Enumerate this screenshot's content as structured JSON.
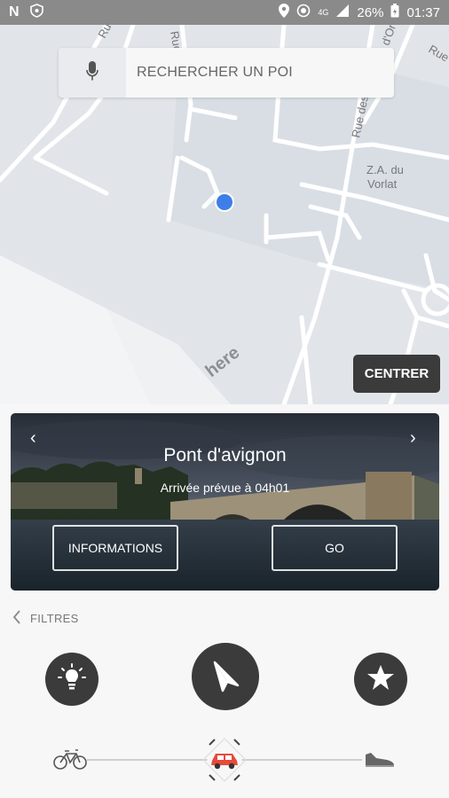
{
  "status_bar": {
    "battery": "26%",
    "time": "01:37",
    "network": "4G"
  },
  "map": {
    "street_labels": [
      "Rue de",
      "Rue d",
      "Rue des",
      "d'Or",
      "Rue",
      "Z.A. du",
      "Vorlat"
    ],
    "watermark": "here"
  },
  "search": {
    "placeholder": "RECHERCHER UN POI"
  },
  "center_button": "CENTRER",
  "poi_card": {
    "title": "Pont d'avignon",
    "eta": "Arrivée prévue à 04h01",
    "info_button": "INFORMATIONS",
    "go_button": "GO",
    "prev_icon": "chevron-left-icon",
    "next_icon": "chevron-right-icon"
  },
  "filters": {
    "label": "FILTRES"
  },
  "actions": [
    "lightbulb-icon",
    "navigation-arrow-icon",
    "star-icon"
  ],
  "transport_modes": [
    {
      "name": "bicycle-icon",
      "selected": false
    },
    {
      "name": "car-icon",
      "selected": true
    },
    {
      "name": "walking-shoe-icon",
      "selected": false
    }
  ],
  "colors": {
    "accent_dark": "#3b3b3b",
    "location_dot": "#3d7ee8",
    "car_selected": "#e64a3b"
  }
}
